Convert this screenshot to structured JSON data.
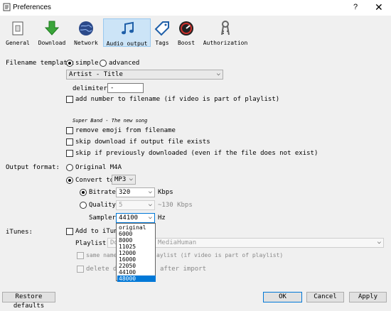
{
  "window": {
    "title": "Preferences",
    "help": "?",
    "close": "✕"
  },
  "toolbar": [
    {
      "name": "general",
      "label": "General",
      "icon": "document-icon"
    },
    {
      "name": "download",
      "label": "Download",
      "icon": "download-arrow-icon"
    },
    {
      "name": "network",
      "label": "Network",
      "icon": "globe-icon"
    },
    {
      "name": "audio-output",
      "label": "Audio output",
      "icon": "music-note-icon",
      "selected": true
    },
    {
      "name": "tags",
      "label": "Tags",
      "icon": "tag-icon"
    },
    {
      "name": "boost",
      "label": "Boost",
      "icon": "speedometer-icon"
    },
    {
      "name": "authorization",
      "label": "Authorization",
      "icon": "keys-icon"
    }
  ],
  "filename": {
    "label": "Filename template:",
    "simple": "simple",
    "advanced": "advanced",
    "template_value": "Artist - Title",
    "delimiter_label": "delimiter:",
    "delimiter_value": "-",
    "add_number": "add number to filename (if video is part of playlist)",
    "example": "Super Band - The new song",
    "remove_emoji": "remove emoji from filename",
    "skip_exists": "skip download if output file exists",
    "skip_previous": "skip if previously downloaded (even if the file does not exist)"
  },
  "output": {
    "label": "Output format:",
    "original": "Original M4A",
    "convert_to": "Convert to",
    "format_value": "MP3",
    "bitrate_label": "Bitrate",
    "bitrate_value": "320",
    "bitrate_unit": "Kbps",
    "quality_label": "Quality",
    "quality_value": "5",
    "quality_hint": "~130 Kbps",
    "samplerate_label": "Samplerate",
    "samplerate_value": "44100",
    "samplerate_unit": "Hz",
    "samplerate_options": [
      "original",
      "6000",
      "8000",
      "11025",
      "12000",
      "16000",
      "22050",
      "44100",
      "48000"
    ],
    "samplerate_highlight": "48000"
  },
  "itunes": {
    "label": "iTunes:",
    "add_to": "Add to iTunes",
    "playlist_label": "Playlist:",
    "playlist_value": "Do",
    "playlist_value_end": "MediaHuman",
    "same_name_start": "same name",
    "same_name_end": "aylist (if video is part of playlist)",
    "delete_start": "delete do",
    "delete_end": "after import"
  },
  "buttons": {
    "restore": "Restore defaults",
    "ok": "OK",
    "cancel": "Cancel",
    "apply": "Apply"
  },
  "colors": {
    "selection": "#0078d7",
    "tab_selected": "#cce4f7"
  }
}
